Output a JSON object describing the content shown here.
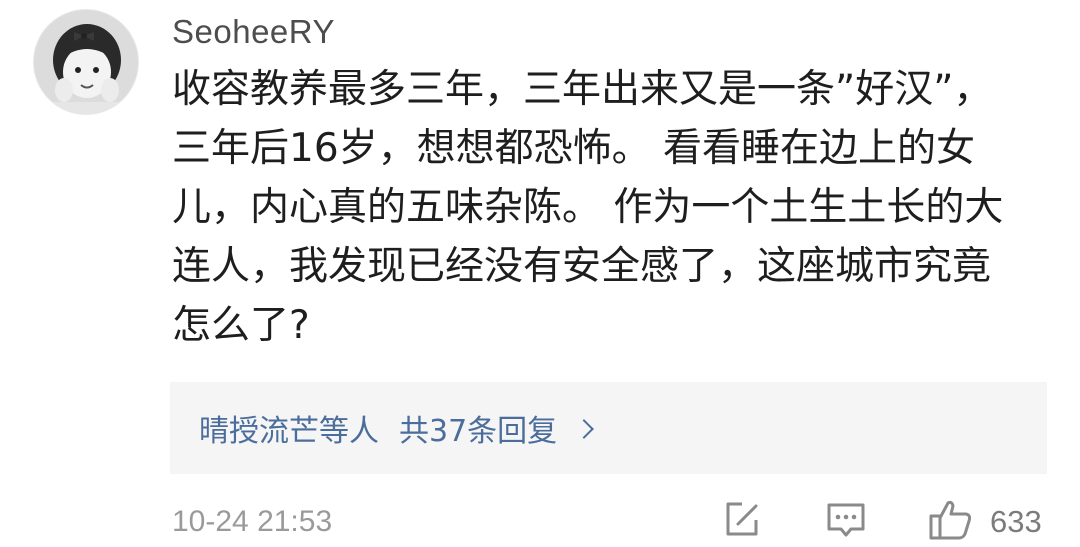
{
  "comment": {
    "username": "SeoheeRY",
    "text_lines": [
      "收容教养最多三年，三年出来又是一条”好汉”，",
      "三年后16岁，想想都恐怖。 看看睡在边上的女",
      "儿，内心真的五味杂陈。 作为一个土生土长的大",
      "连人，我发现已经没有安全感了，这座城市究竟",
      "怎么了?"
    ],
    "replies": {
      "users": "晴授流芒等人",
      "count_label": "共37条回复"
    },
    "timestamp": "10-24 21:53",
    "like_count": "633",
    "icons": {
      "share": "share-icon",
      "comment": "comment-icon",
      "like": "thumbs-up-icon",
      "reply_arrow": "chevron-right-icon"
    },
    "colors": {
      "link": "#4b6d9c",
      "reply_bg": "#f5f5f5",
      "muted": "#9a9a9a"
    }
  }
}
